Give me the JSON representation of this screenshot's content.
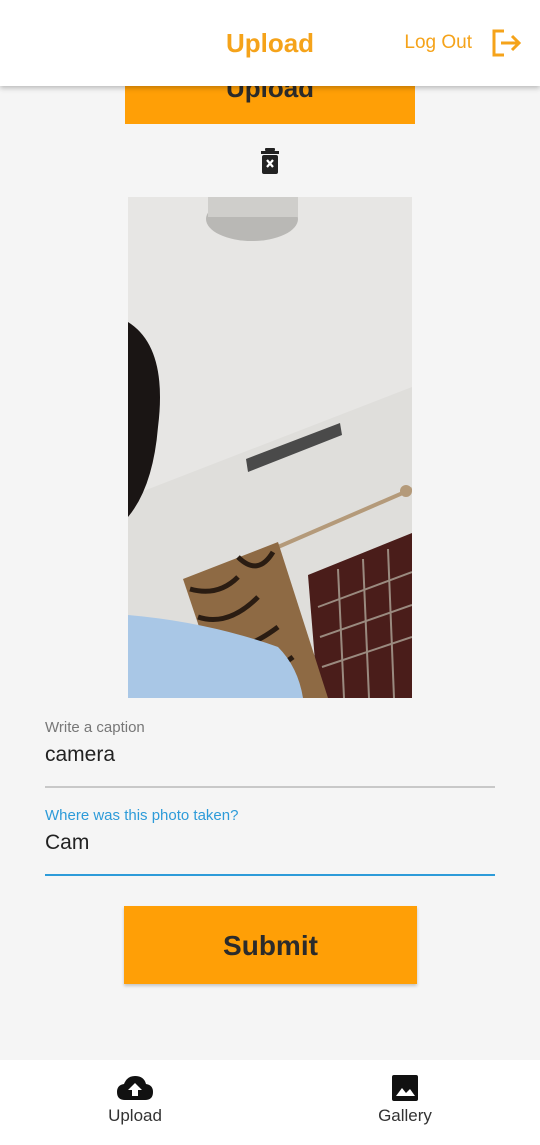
{
  "appbar": {
    "title": "Upload",
    "logout_label": "Log Out",
    "logout_icon": "logout-icon",
    "accent_color": "#f5a31a"
  },
  "main": {
    "upload_button_label": "Upload",
    "delete_icon": "delete-icon",
    "caption": {
      "label": "Write a caption",
      "value": "camera"
    },
    "location": {
      "label": "Where was this photo taken?",
      "value": "Cam"
    },
    "submit_label": "Submit",
    "button_color": "#ff9f06",
    "focus_color": "#2d9bd9"
  },
  "bottom_nav": {
    "items": [
      {
        "label": "Upload",
        "icon": "cloud-upload-icon"
      },
      {
        "label": "Gallery",
        "icon": "image-icon"
      }
    ]
  }
}
